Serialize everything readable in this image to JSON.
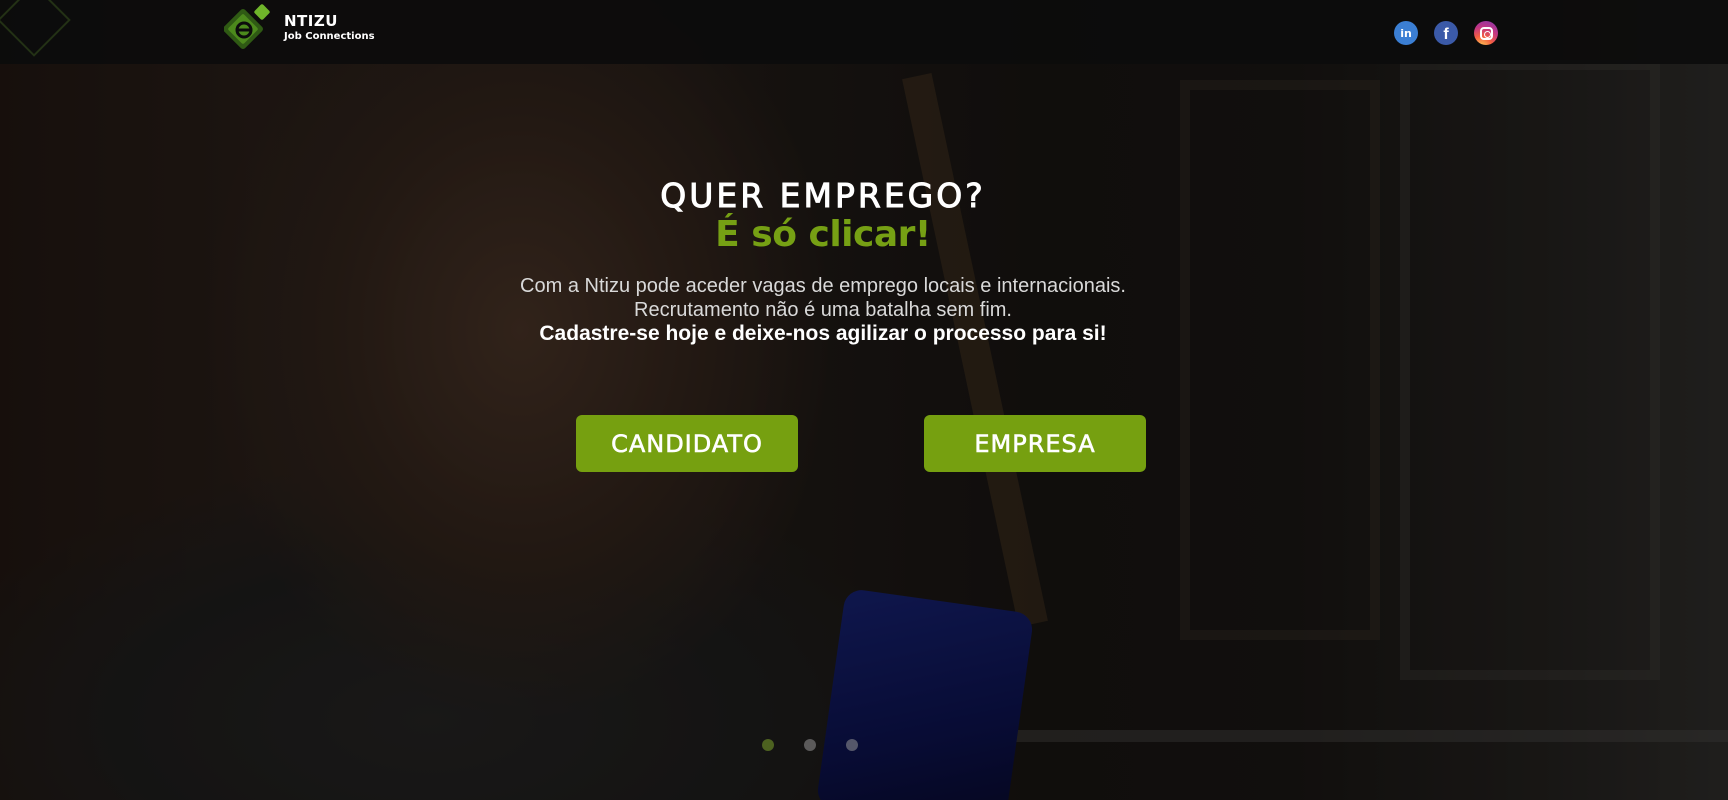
{
  "header": {
    "brand_name": "NTIZU",
    "brand_sub": "Job Connections",
    "social": [
      {
        "name": "linkedin-icon",
        "glyph": "in"
      },
      {
        "name": "facebook-icon",
        "glyph": "f"
      },
      {
        "name": "instagram-icon",
        "glyph": ""
      }
    ]
  },
  "hero": {
    "headline": "QUER EMPREGO?",
    "subheadline": "É só clicar!",
    "desc_line1": "Com a Ntizu pode aceder vagas de emprego locais e internacionais.",
    "desc_line2": "Recrutamento não é uma batalha sem fim.",
    "desc_strong": "Cadastre-se hoje e deixe-nos agilizar o processo para si!",
    "cta_candidato": "CANDIDATO",
    "cta_empresa": "EMPRESA"
  },
  "carousel": {
    "slide_count": 3,
    "active_index": 0
  },
  "colors": {
    "accent_green": "#76a010",
    "header_bg": "#0c0c0c",
    "linkedin": "#3b7fd4",
    "facebook": "#3b5aa8"
  }
}
